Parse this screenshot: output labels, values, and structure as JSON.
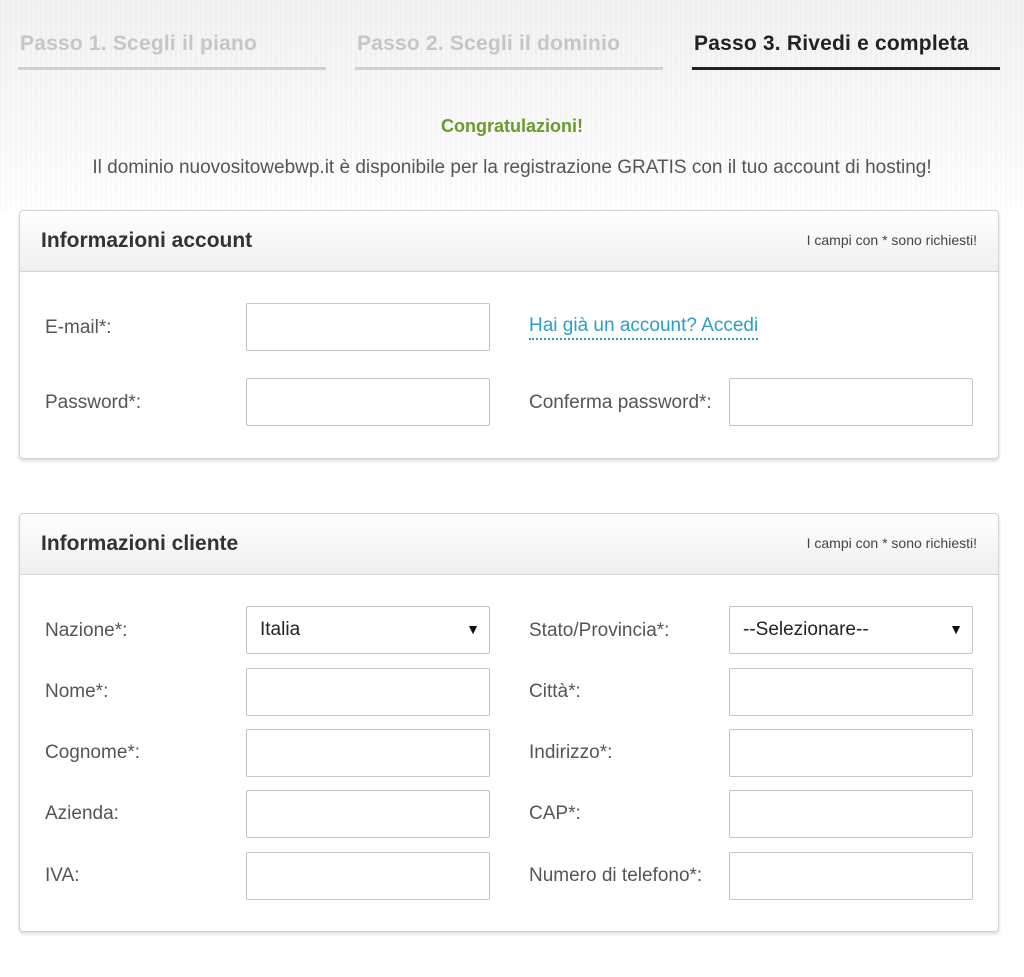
{
  "steps": [
    {
      "label": "Passo 1. Scegli il piano",
      "state": "inactive"
    },
    {
      "label": "Passo 2. Scegli il dominio",
      "state": "inactive"
    },
    {
      "label": "Passo 3. Rivedi e completa",
      "state": "active"
    }
  ],
  "banner": {
    "congrats": "Congratulazioni!",
    "message": "Il dominio nuovositowebwp.it è disponibile per la registrazione GRATIS con il tuo account di hosting!"
  },
  "account": {
    "title": "Informazioni account",
    "required_note": "I campi con * sono richiesti!",
    "email_label": "E-mail*:",
    "email_value": "",
    "login_link": "Hai già un account? Accedi",
    "password_label": "Password*:",
    "password_value": "",
    "confirm_password_label": "Conferma password*:",
    "confirm_password_value": ""
  },
  "cliente": {
    "title": "Informazioni cliente",
    "required_note": "I campi con * sono richiesti!",
    "nazione_label": "Nazione*:",
    "nazione_value": "Italia",
    "stato_label": "Stato/Provincia*:",
    "stato_value": "--Selezionare--",
    "nome_label": "Nome*:",
    "nome_value": "",
    "citta_label": "Città*:",
    "citta_value": "",
    "cognome_label": "Cognome*:",
    "cognome_value": "",
    "indirizzo_label": "Indirizzo*:",
    "indirizzo_value": "",
    "azienda_label": "Azienda:",
    "azienda_value": "",
    "cap_label": "CAP*:",
    "cap_value": "",
    "iva_label": "IVA:",
    "iva_value": "",
    "telefono_label": "Numero di telefono*:",
    "telefono_value": ""
  },
  "colors": {
    "congrats": "#6a9a2c",
    "link": "#2b9ec4",
    "active_step": "#222222",
    "inactive_step": "#c6c6c6"
  },
  "icons": {
    "select_caret": "caret-down-icon"
  }
}
